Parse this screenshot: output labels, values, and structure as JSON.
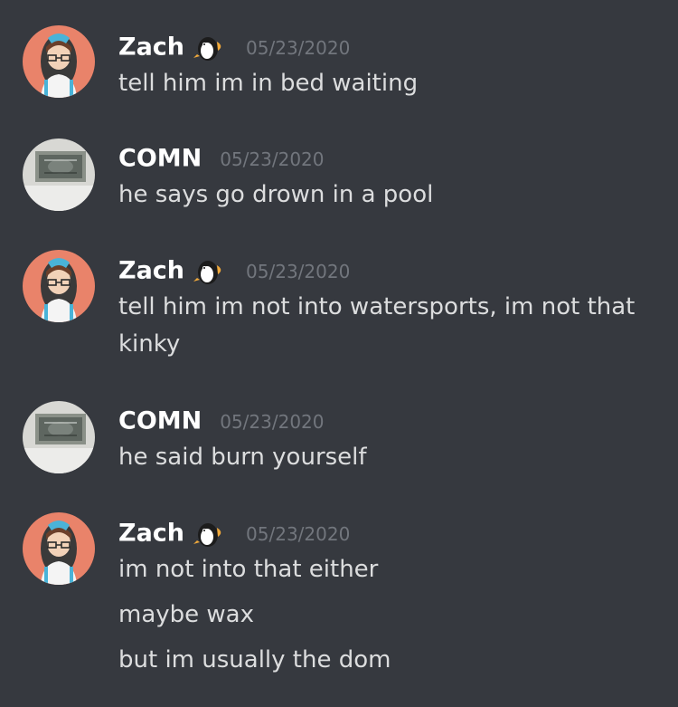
{
  "messages": [
    {
      "author": "Zach",
      "has_badge": true,
      "timestamp": "05/23/2020",
      "lines": [
        "tell him im in bed waiting"
      ]
    },
    {
      "author": "COMN",
      "has_badge": false,
      "timestamp": "05/23/2020",
      "lines": [
        "he says go drown in a pool"
      ]
    },
    {
      "author": "Zach",
      "has_badge": true,
      "timestamp": "05/23/2020",
      "lines": [
        "tell him im not into watersports, im not that kinky"
      ]
    },
    {
      "author": "COMN",
      "has_badge": false,
      "timestamp": "05/23/2020",
      "lines": [
        "he said burn yourself"
      ]
    },
    {
      "author": "Zach",
      "has_badge": true,
      "timestamp": "05/23/2020",
      "lines": [
        "im not into that either",
        "maybe wax",
        "but im usually the dom"
      ]
    }
  ],
  "icons": {
    "zach_avatar": "anime-character-avatar",
    "comn_avatar": "photo-avatar",
    "badge": "penguin-icon"
  },
  "colors": {
    "background": "#36393f",
    "username": "#ffffff",
    "timestamp": "#72767d",
    "message_text": "#dcddde"
  }
}
